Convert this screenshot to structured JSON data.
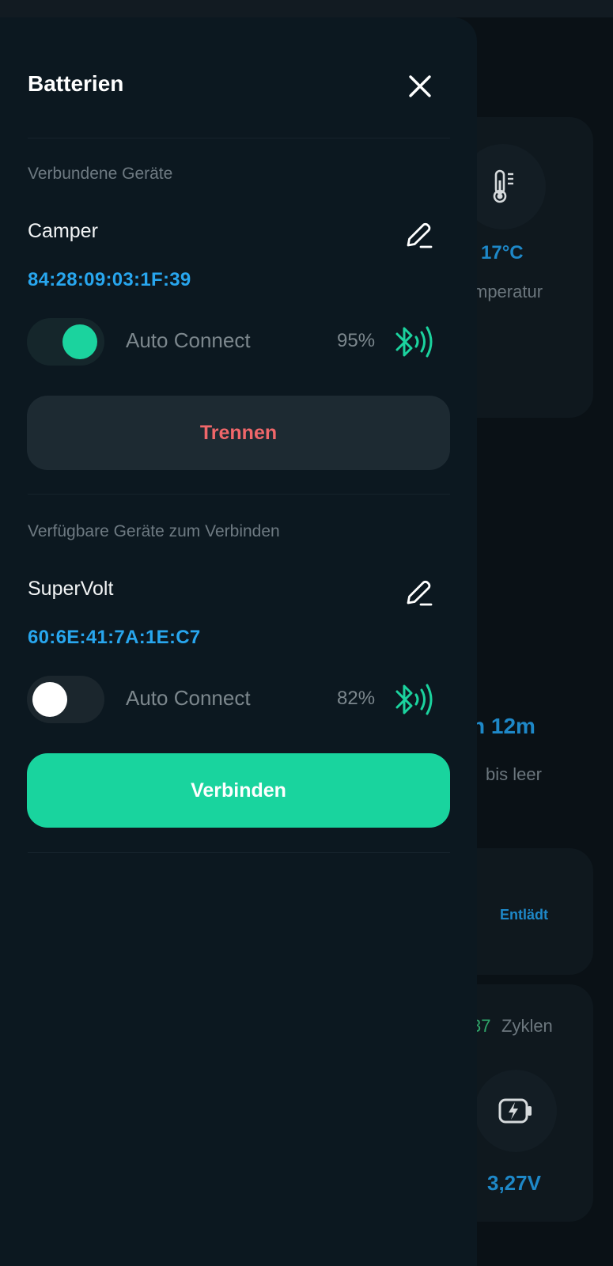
{
  "drawer": {
    "title": "Batterien",
    "connected": {
      "section_label": "Verbundene Geräte",
      "device_name": "Camper",
      "mac": "84:28:09:03:1F:39",
      "auto_connect_label": "Auto Connect",
      "auto_connect": true,
      "signal": "95%",
      "button_label": "Trennen"
    },
    "available": {
      "section_label": "Verfügbare Geräte zum Verbinden",
      "device_name": "SuperVolt",
      "mac": "60:6E:41:7A:1E:C7",
      "auto_connect_label": "Auto Connect",
      "auto_connect": false,
      "signal": "82%",
      "button_label": "Verbinden"
    }
  },
  "background": {
    "temperature_value": "17°C",
    "temperature_label": "mperatur",
    "time_value": "h 12m",
    "time_label": "bis leer",
    "status": "Entlädt",
    "cycles_value": "37",
    "cycles_label": "Zyklen",
    "voltage_value": "3,27V"
  },
  "colors": {
    "accent_green": "#1bd39e",
    "mac_blue": "#28a6ee",
    "disconnect_red": "#f0676a"
  },
  "icons": {
    "close": "close-icon",
    "edit": "pencil-icon",
    "signal": "bluetooth-signal-icon",
    "thermometer": "thermometer-icon",
    "battery": "battery-charge-icon"
  }
}
